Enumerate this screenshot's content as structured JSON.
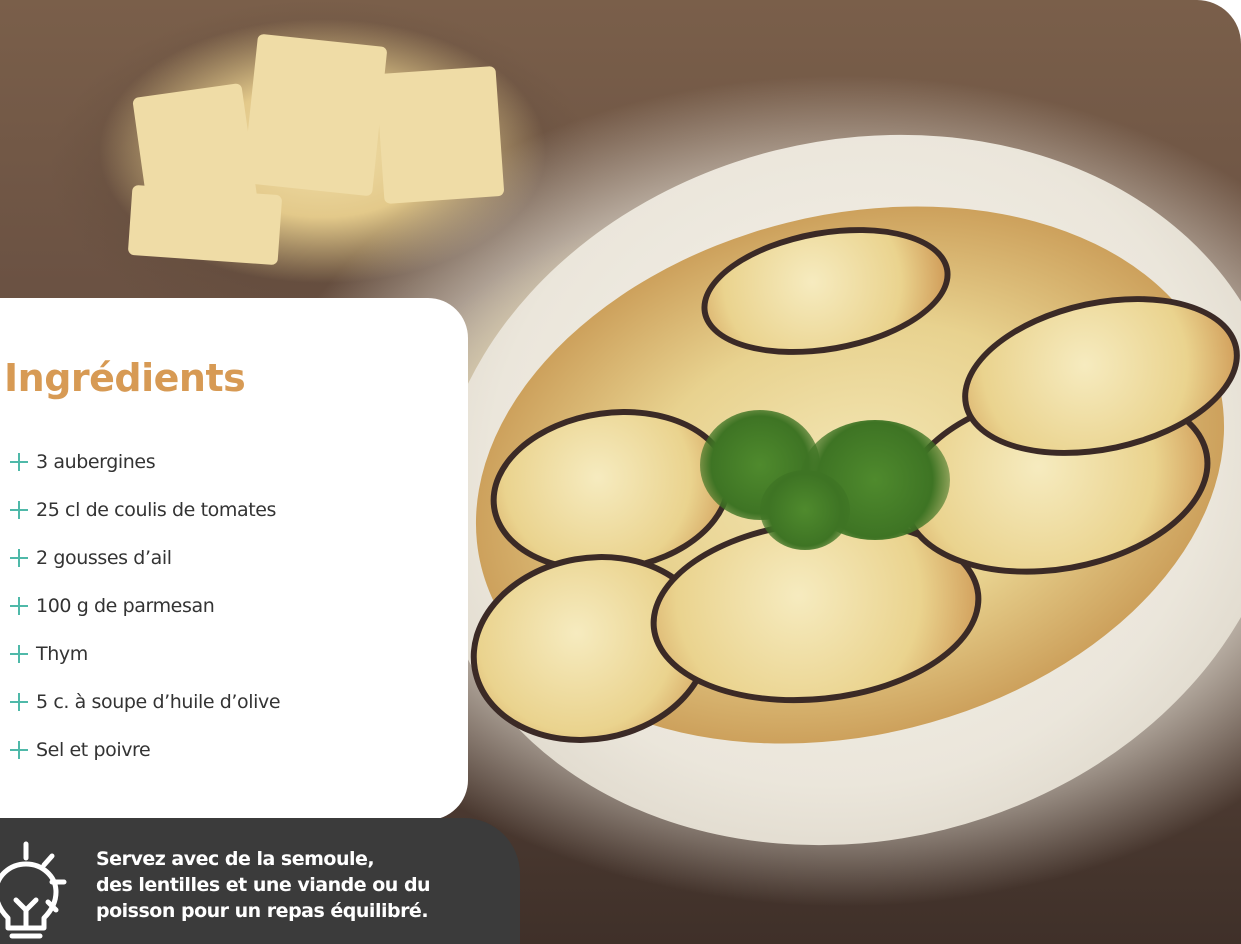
{
  "ingredients": {
    "title": "Ingrédients",
    "items": [
      "3 aubergines",
      "25 cl de coulis de tomates",
      "2 gousses d’ail",
      "100 g de parmesan",
      "Thym",
      "5 c. à soupe d’huile d’olive",
      "Sel et poivre"
    ]
  },
  "tip": {
    "icon": "lightbulb-icon",
    "lines": [
      "Servez avec de la semoule,",
      "des lentilles et une viande ou du",
      "poisson pour un repas équilibré."
    ]
  },
  "colors": {
    "title": "#d79a54",
    "bullet": "#4fb9a9",
    "tip_background": "#3b3b3b"
  }
}
